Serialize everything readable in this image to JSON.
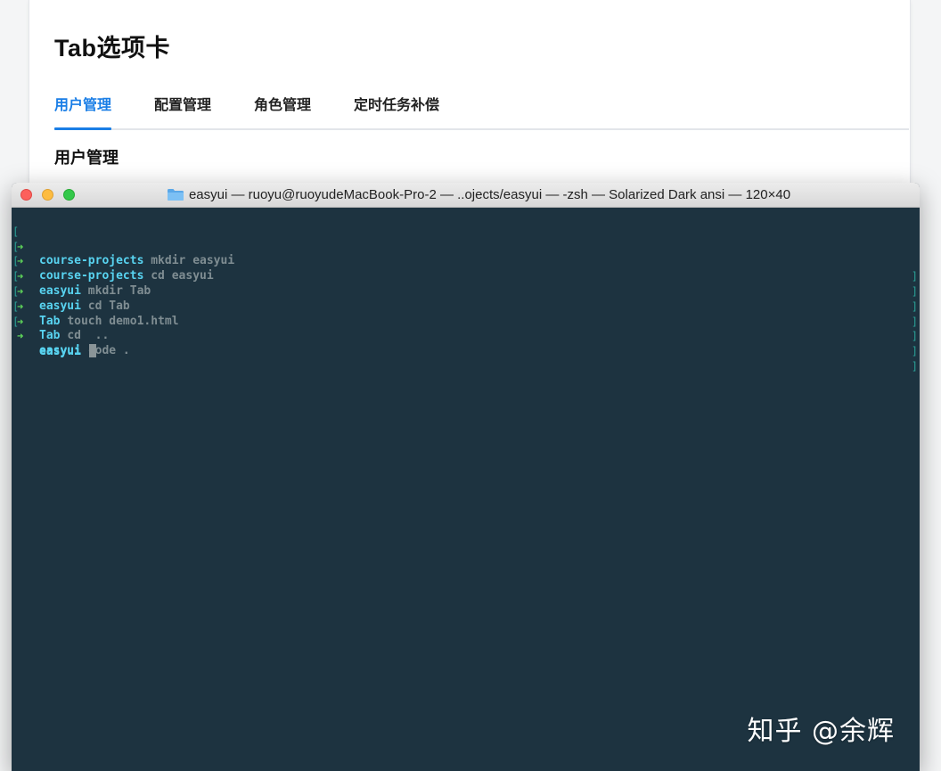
{
  "webpage": {
    "title": "Tab选项卡",
    "tabs": [
      {
        "label": "用户管理",
        "active": true
      },
      {
        "label": "配置管理",
        "active": false
      },
      {
        "label": "角色管理",
        "active": false
      },
      {
        "label": "定时任务补偿",
        "active": false
      }
    ],
    "content_title": "用户管理",
    "accent_color": "#1a7ee6"
  },
  "terminal": {
    "title": "easyui — ruoyu@ruoyudeMacBook-Pro-2 — ..ojects/easyui — -zsh — Solarized Dark ansi — 120×40",
    "folder_icon": "folder-icon",
    "background_color": "#1d3340",
    "lines": [
      {
        "dir": "course-projects",
        "cmd": "mkdir easyui"
      },
      {
        "dir": "course-projects",
        "cmd": "cd easyui"
      },
      {
        "dir": "easyui",
        "cmd": "mkdir Tab"
      },
      {
        "dir": "easyui",
        "cmd": "cd Tab"
      },
      {
        "dir": "Tab",
        "cmd": "touch demo1.html"
      },
      {
        "dir": "Tab",
        "cmd": "cd  .."
      },
      {
        "dir": "easyui",
        "cmd": "code ."
      },
      {
        "dir": "easyui",
        "cmd": ""
      }
    ],
    "prompt_symbol": "➜",
    "bracket_left": "[",
    "bracket_right": "]"
  },
  "watermark": "知乎 @余辉"
}
